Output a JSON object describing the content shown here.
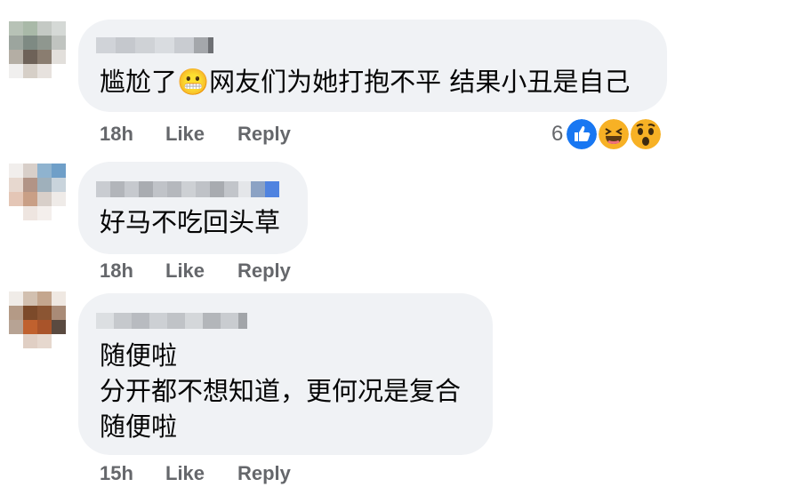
{
  "comments": [
    {
      "text": "尴尬了😬网友们为她打抱不平 结果小丑是自己",
      "time": "18h",
      "like_label": "Like",
      "reply_label": "Reply",
      "reaction_count": "6",
      "reactions": [
        "like-icon",
        "laughing-icon",
        "surprised-icon"
      ]
    },
    {
      "text": "好马不吃回头草",
      "time": "18h",
      "like_label": "Like",
      "reply_label": "Reply"
    },
    {
      "lines": [
        "随便啦",
        "分开都不想知道，更何况是复合",
        "随便啦"
      ],
      "time": "15h",
      "like_label": "Like",
      "reply_label": "Reply"
    }
  ],
  "colors": {
    "bubble": "#f0f2f5",
    "meta_text": "#65676b",
    "like_blue": "#1877f2",
    "emoji_yellow": "#f7b125"
  }
}
